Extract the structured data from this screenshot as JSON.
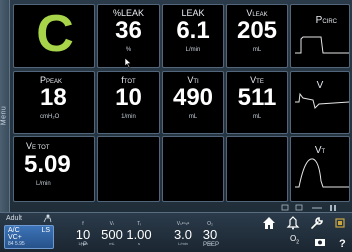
{
  "menu": {
    "label": "Menu"
  },
  "mode": {
    "letter": "C"
  },
  "tiles": [
    {
      "id": "leak-pct",
      "title": "%LEAK",
      "value": "36",
      "unit": "%"
    },
    {
      "id": "leak",
      "title": "LEAK",
      "value": "6.1",
      "unit": "L/min"
    },
    {
      "id": "vleak",
      "title_main": "V",
      "title_sub": "LEAK",
      "value": "205",
      "unit": "mL"
    },
    {
      "id": "ppeak",
      "title_main": "P",
      "title_sub": "PEAK",
      "value": "18",
      "unit": "cmH₂O"
    },
    {
      "id": "ftot",
      "title_main": "f",
      "title_sub": "TOT",
      "value": "10",
      "unit": "1/min"
    },
    {
      "id": "vti",
      "title_main": "V",
      "title_sub": "TI",
      "value": "490",
      "unit": "mL"
    },
    {
      "id": "vte",
      "title_main": "V",
      "title_sub": "TE",
      "value": "511",
      "unit": "mL"
    },
    {
      "id": "vetot",
      "title_main": "V",
      "title_sub": "E TOT",
      "value": "5.09",
      "unit": "L/min"
    }
  ],
  "waveforms": {
    "pcirc": {
      "title_main": "P",
      "title_sub": "CIRC"
    },
    "flow": {
      "title": "V"
    },
    "volume": {
      "title_main": "V",
      "title_sub": "T"
    }
  },
  "bottom": {
    "patient_type": "Adult",
    "mode_line1": "A/C",
    "mode_line2": "VC+",
    "mode_ls": "LS",
    "mode_small": "84",
    "mode_small2": "5.95",
    "settings": [
      {
        "label": "f",
        "value": "10",
        "unit": "1/min"
      },
      {
        "label": "Vₜ",
        "value": "500",
        "unit": "mL"
      },
      {
        "label": "Tᵢ",
        "value": "1.00",
        "unit": "s"
      },
      {
        "label": "Vₛᵉⁿₛᵉ",
        "value": "3.0",
        "unit": "L/min"
      },
      {
        "label": "O₂",
        "value": "30",
        "unit": "%"
      }
    ],
    "under_left": "↑P",
    "under_peep": "PEEP",
    "o2_label": "O",
    "o2_sub": "2"
  },
  "colors": {
    "mode_letter": "#a8d44a",
    "tile_bg": "#000000",
    "mode_button": "#3d74b8"
  }
}
